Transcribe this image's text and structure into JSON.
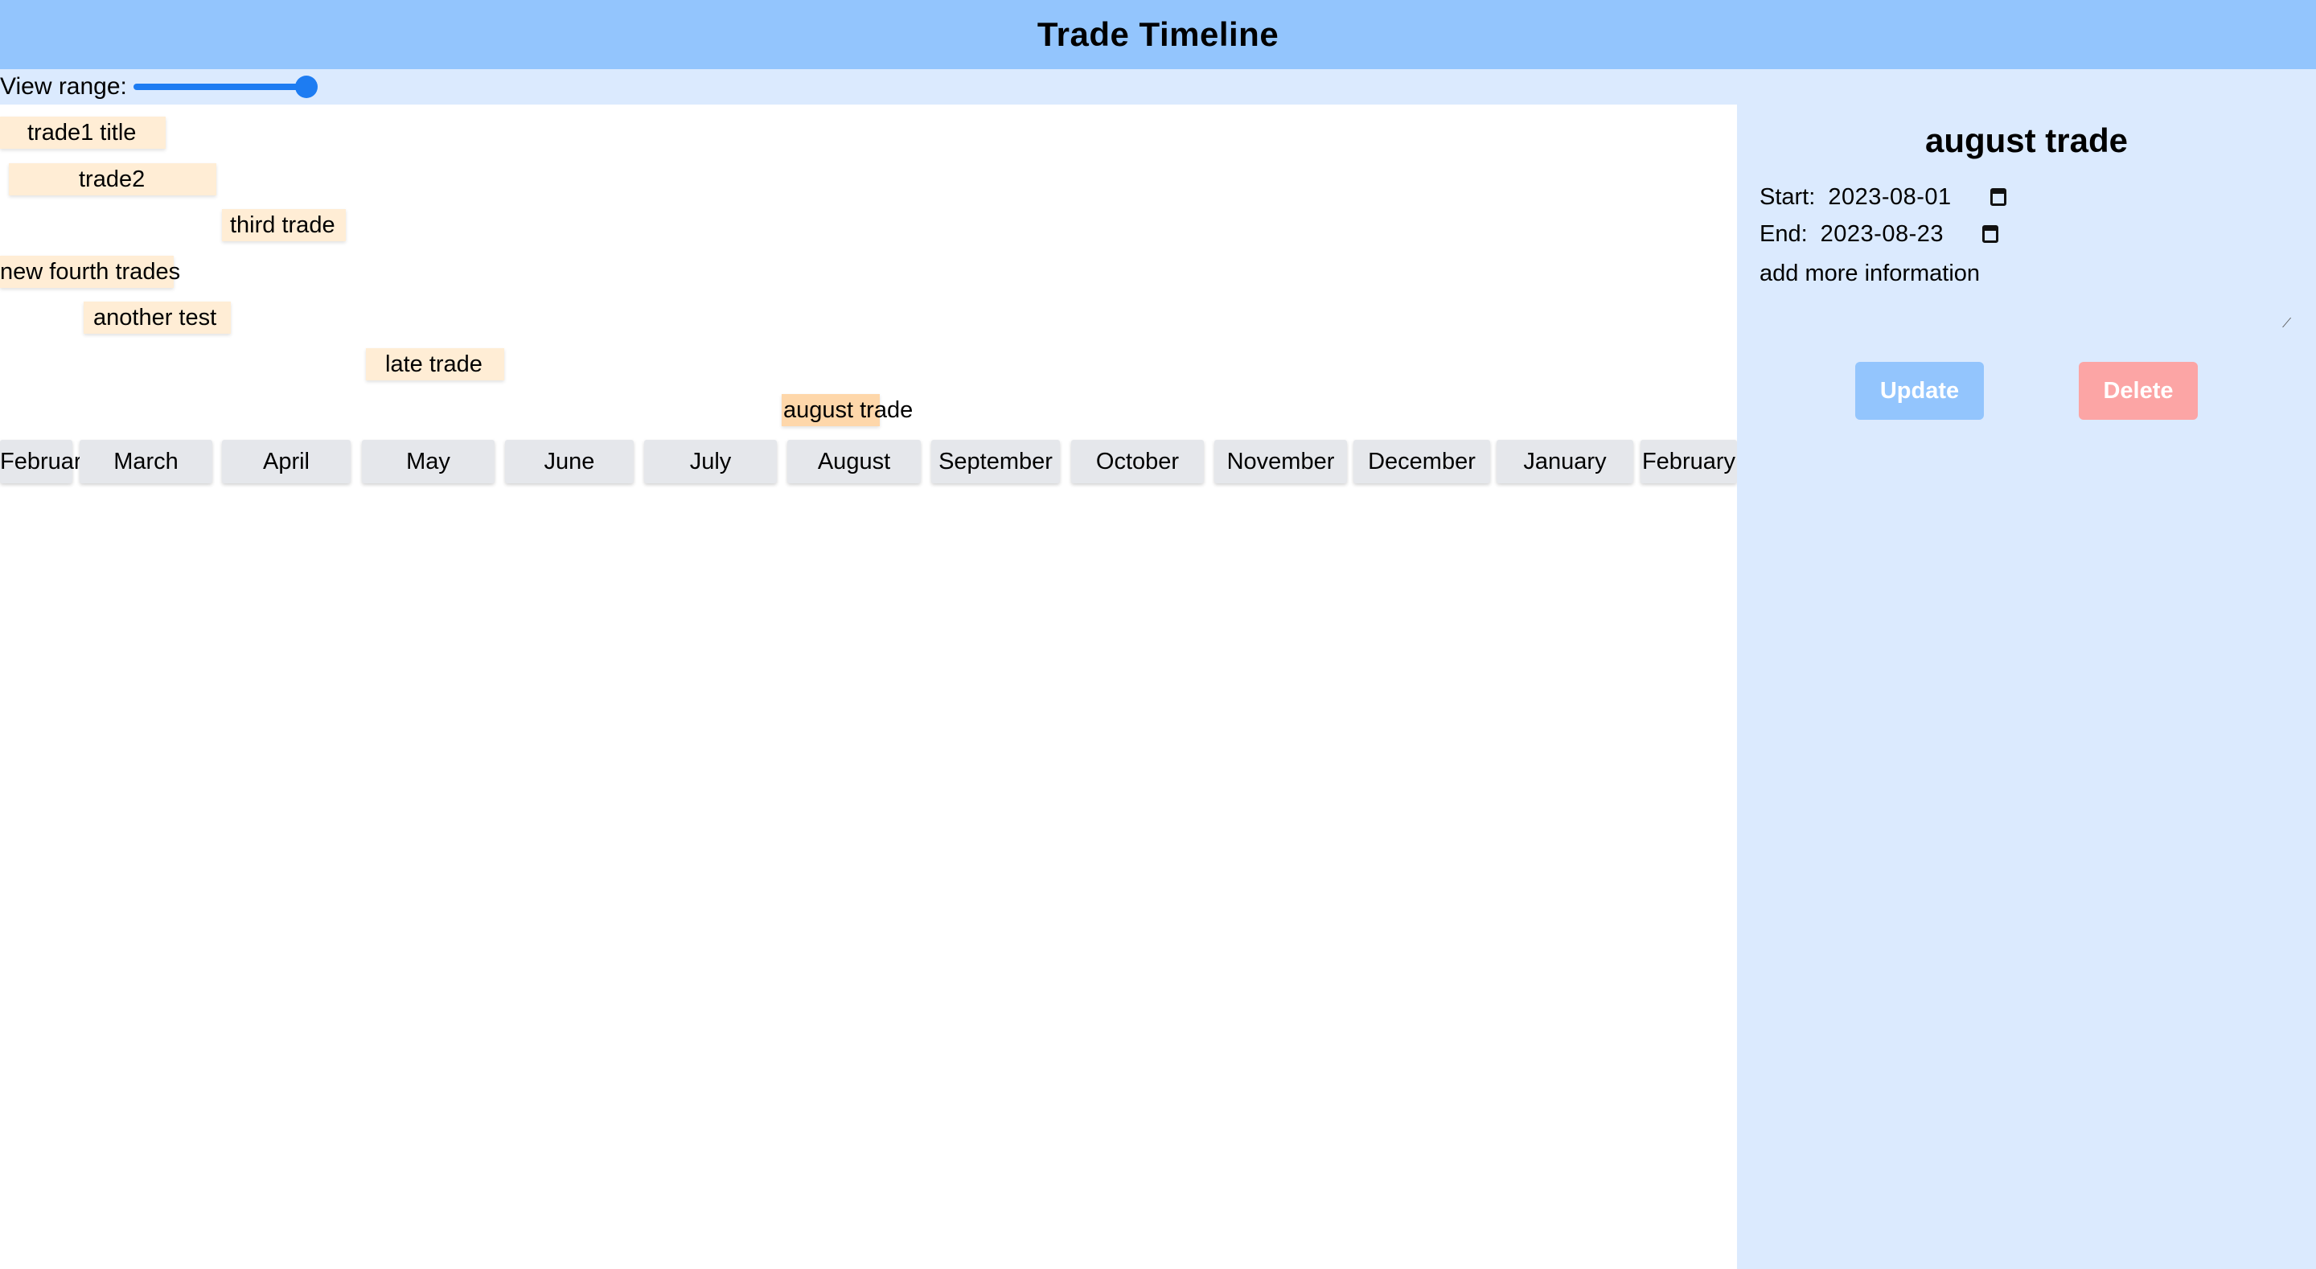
{
  "header": {
    "title": "Trade Timeline"
  },
  "toolbar": {
    "view_range_label": "View range:",
    "view_range_value": 1.0
  },
  "trades": [
    {
      "title": "trade1 title",
      "selected": false
    },
    {
      "title": "trade2",
      "selected": false
    },
    {
      "title": "third trade",
      "selected": false
    },
    {
      "title": "new fourth trades",
      "selected": false
    },
    {
      "title": "another test",
      "selected": false
    },
    {
      "title": "late trade",
      "selected": false
    },
    {
      "title": "august trade",
      "selected": true
    }
  ],
  "months": [
    "February",
    "March",
    "April",
    "May",
    "June",
    "July",
    "August",
    "September",
    "October",
    "November",
    "December",
    "January",
    "February"
  ],
  "detail": {
    "title": "august trade",
    "start_label": "Start:",
    "start_value": "2023-08-01",
    "end_label": "End:",
    "end_value": "2023-08-23",
    "notes": "add more information",
    "update_label": "Update",
    "delete_label": "Delete"
  },
  "colors": {
    "header": "#93c5fd",
    "panel": "#dbeafe",
    "trade": "#ffedd5",
    "trade_selected": "#fed7aa",
    "month": "#e5e7eb",
    "update": "#93c5fd",
    "delete": "#fca5a5",
    "slider": "#1d7cf2"
  }
}
